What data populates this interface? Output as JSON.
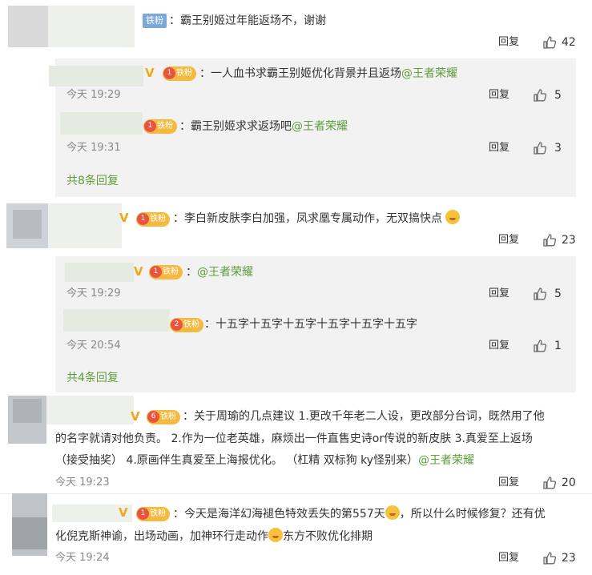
{
  "comments": [
    {
      "badge": "铁粉",
      "text": "：霸王别姬过年能返场不，谢谢",
      "reply_label": "回复",
      "likes": "42",
      "replies": [
        {
          "tie_level": "1",
          "tie_label": "铁粉",
          "text_prefix": "：一人血书求霸王别姬优化背景并且返场",
          "mention": "@王者荣耀",
          "time": "今天 19:29",
          "reply_label": "回复",
          "likes": "5"
        },
        {
          "tie_level": "1",
          "tie_label": "铁粉",
          "text_prefix": "：霸王别姬求求返场吧",
          "mention": "@王者荣耀",
          "time": "今天 19:31",
          "reply_label": "回复",
          "likes": "3"
        }
      ],
      "more": "共8条回复"
    },
    {
      "tie_level": "1",
      "tie_label": "铁粉",
      "text": "：李白新皮肤李白加强，凤求凰专属动作，无双搞快点",
      "reply_label": "回复",
      "likes": "23",
      "replies": [
        {
          "tie_level": "1",
          "tie_label": "铁粉",
          "text_prefix": "：",
          "mention": "@王者荣耀",
          "time": "今天 19:29",
          "reply_label": "回复",
          "likes": "5"
        },
        {
          "tie_level": "2",
          "tie_label": "铁粉",
          "text_prefix": "：十五字十五字十五字十五字十五字十五字",
          "mention": "",
          "time": "今天 20:54",
          "reply_label": "回复",
          "likes": "1"
        }
      ],
      "more": "共4条回复"
    },
    {
      "tie_level": "6",
      "tie_label": "铁粉",
      "line1": "：关于周瑜的几点建议 1.更改千年老二人设，更改部分台词，既然用了他",
      "line2": "的名字就请对他负责。 2.作为一位老英雄，麻烦出一件直售史诗or传说的新皮肤 3.真爱至上返场",
      "line3_prefix": "（接受抽奖） 4.原画伴生真爱至上海报优化。  （杠精 双标狗 ky怪别来）",
      "mention": "@王者荣耀",
      "time": "今天 19:23",
      "reply_label": "回复",
      "likes": "20"
    },
    {
      "tie_level": "1",
      "tie_label": "铁粉",
      "line1_prefix": "：今天是海洋幻海褪色特效丢失的第557天",
      "line1_suffix": "，所以什么时候修复？还有优",
      "line2_prefix": "化倪克斯神谕，出场动画，加神环行走动作",
      "line2_suffix": "东方不败优化排期",
      "time": "今天 19:24",
      "reply_label": "回复",
      "likes": "23"
    }
  ],
  "colors": {
    "mention": "#5d9e3a",
    "more": "#5d9e3a",
    "reply_bg": "#f2f2f2",
    "fan_badge": "#7ba8d9",
    "tie_badge": "#f4b93f",
    "vip_mark": "#f1a71a"
  }
}
